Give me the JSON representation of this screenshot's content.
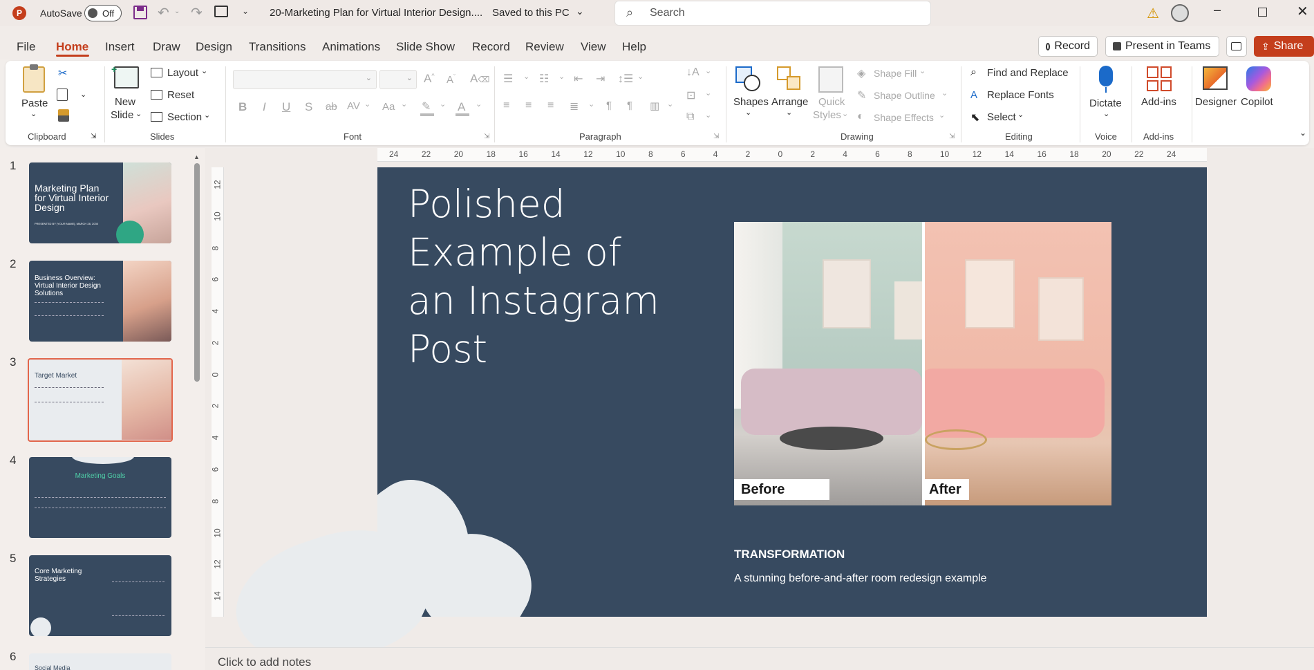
{
  "titlebar": {
    "autosave_label": "AutoSave",
    "autosave_state": "Off",
    "document_title": "20-Marketing Plan for Virtual Interior Design....",
    "save_status": "Saved to this PC",
    "search_placeholder": "Search"
  },
  "menu": {
    "tabs": [
      "File",
      "Home",
      "Insert",
      "Draw",
      "Design",
      "Transitions",
      "Animations",
      "Slide Show",
      "Record",
      "Review",
      "View",
      "Help"
    ],
    "active_tab": "Home",
    "record_button": "Record",
    "present_button": "Present in Teams",
    "share_button": "Share"
  },
  "ribbon": {
    "clipboard": {
      "paste": "Paste",
      "group": "Clipboard"
    },
    "slides": {
      "new_slide_1": "New",
      "new_slide_2": "Slide",
      "layout": "Layout",
      "reset": "Reset",
      "section": "Section",
      "group": "Slides"
    },
    "font": {
      "group": "Font",
      "bold": "B",
      "italic": "I",
      "underline": "U",
      "strike": "S",
      "abc": "ab",
      "spacing": "AV",
      "case": "Aa",
      "color": "A"
    },
    "paragraph": {
      "group": "Paragraph"
    },
    "drawing": {
      "shapes": "Shapes",
      "arrange": "Arrange",
      "quick_styles_1": "Quick",
      "quick_styles_2": "Styles",
      "shape_fill": "Shape Fill",
      "shape_outline": "Shape Outline",
      "shape_effects": "Shape Effects",
      "group": "Drawing"
    },
    "editing": {
      "find_replace": "Find and Replace",
      "replace_fonts": "Replace Fonts",
      "select": "Select",
      "group": "Editing"
    },
    "voice": {
      "dictate": "Dictate",
      "group": "Voice"
    },
    "addins": {
      "addins": "Add-ins",
      "group": "Add-ins"
    },
    "designer": "Designer",
    "copilot": "Copilot"
  },
  "ruler": {
    "h_ticks": [
      "24",
      "22",
      "20",
      "18",
      "16",
      "14",
      "12",
      "10",
      "8",
      "6",
      "4",
      "2",
      "0",
      "2",
      "4",
      "6",
      "8",
      "10",
      "12",
      "14",
      "16",
      "18",
      "20",
      "22",
      "24"
    ],
    "v_ticks": [
      "12",
      "10",
      "8",
      "6",
      "4",
      "2",
      "0",
      "2",
      "4",
      "6",
      "8",
      "10",
      "12",
      "14"
    ]
  },
  "thumbnails": [
    {
      "num": "1",
      "title": "Marketing Plan for Virtual Interior Design",
      "subtitle": "PRESENTED BY [YOUR NAME], MARCH 28, 2030"
    },
    {
      "num": "2",
      "title": "Business Overview: Virtual Interior Design Solutions"
    },
    {
      "num": "3",
      "title": "Target Market"
    },
    {
      "num": "4",
      "title": "Marketing Goals"
    },
    {
      "num": "5",
      "title": "Core Marketing Strategies"
    },
    {
      "num": "6",
      "title": "Social Media"
    }
  ],
  "slide": {
    "title_lines": [
      "Polished",
      "Example of",
      "an Instagram",
      "Post"
    ],
    "before_label": "Before",
    "after_label": "After",
    "heading": "TRANSFORMATION",
    "caption": "A stunning before-and-after room redesign example"
  },
  "notes_placeholder": "Click to add notes",
  "colors": {
    "accent": "#c43e1c",
    "slide_bg": "#374a60",
    "share_bg": "#c43e1c",
    "selected_thumb": "#e2654b"
  }
}
